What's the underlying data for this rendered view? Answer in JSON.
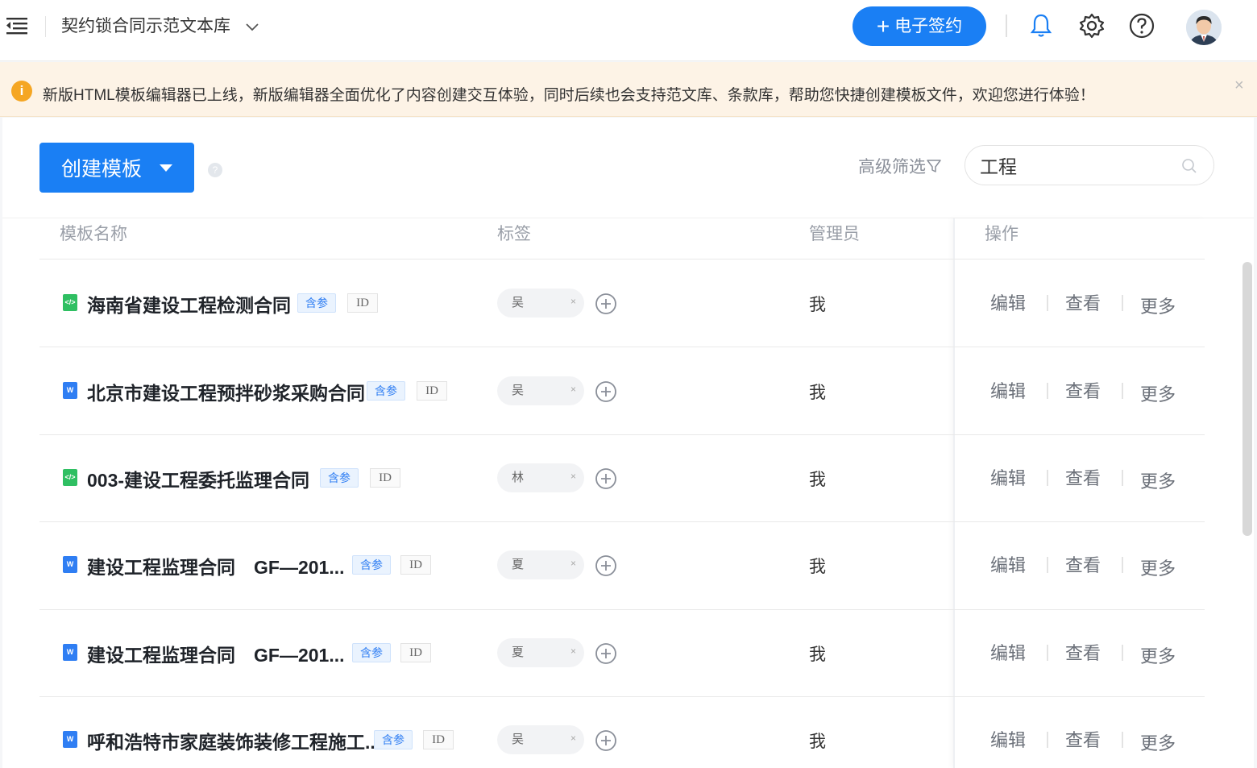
{
  "header": {
    "title": "契约锁合同示范文本库",
    "esign_label": "电子签约",
    "esign_plus": "+"
  },
  "notice": {
    "icon_text": "i",
    "text": "新版HTML模板编辑器已上线，新版编辑器全面优化了内容创建交互体验，同时后续也会支持范文库、条款库，帮助您快捷创建模板文件，欢迎您进行体验！",
    "close": "×"
  },
  "toolbar": {
    "create_label": "创建模板",
    "help_text": "?",
    "advanced_filter": "高级筛选",
    "search_value": "工程"
  },
  "table": {
    "headers": {
      "name": "模板名称",
      "tags": "标签",
      "admin": "管理员",
      "ops": "操作"
    },
    "rows": [
      {
        "icon": "html",
        "icon_text": "</>",
        "name": "海南省建设工程检测合同",
        "param": "含参",
        "id": "ID",
        "tag": "吴",
        "admin": "我",
        "edit": "编辑",
        "view": "查看",
        "more": "更多"
      },
      {
        "icon": "word",
        "icon_text": "W",
        "name": "北京市建设工程预拌砂浆采购合同",
        "param": "含参",
        "id": "ID",
        "tag": "吴",
        "admin": "我",
        "edit": "编辑",
        "view": "查看",
        "more": "更多"
      },
      {
        "icon": "html",
        "icon_text": "</>",
        "name": "003-建设工程委托监理合同",
        "param": "含参",
        "id": "ID",
        "tag": "林",
        "admin": "我",
        "edit": "编辑",
        "view": "查看",
        "more": "更多"
      },
      {
        "icon": "word",
        "icon_text": "W",
        "name": "建设工程监理合同　GF—201...",
        "param": "含参",
        "id": "ID",
        "tag": "夏",
        "admin": "我",
        "edit": "编辑",
        "view": "查看",
        "more": "更多"
      },
      {
        "icon": "word",
        "icon_text": "W",
        "name": "建设工程监理合同　GF—201...",
        "param": "含参",
        "id": "ID",
        "tag": "夏",
        "admin": "我",
        "edit": "编辑",
        "view": "查看",
        "more": "更多"
      },
      {
        "icon": "word",
        "icon_text": "W",
        "name": "呼和浩特市家庭装饰装修工程施工...",
        "param": "含参",
        "id": "ID",
        "tag": "吴",
        "admin": "我",
        "edit": "编辑",
        "view": "查看",
        "more": "更多"
      }
    ]
  },
  "colors": {
    "primary": "#1a7ff4",
    "notice_bg": "#fdf3e6",
    "notice_icon": "#f5a623",
    "html_icon": "#2fbf62",
    "word_icon": "#2f7ef3"
  }
}
